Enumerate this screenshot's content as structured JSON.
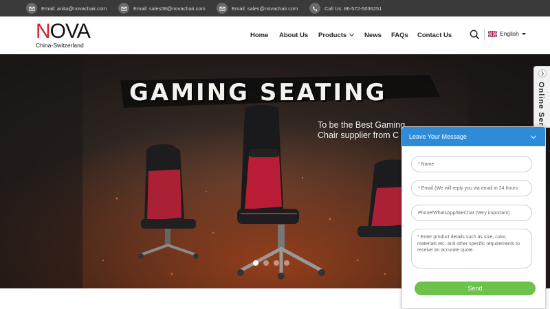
{
  "topbar": {
    "items": [
      {
        "icon": "mail-icon",
        "text": "Email: anita@novachair.com"
      },
      {
        "icon": "mail-icon",
        "text": "Email: sales08@novachair.com"
      },
      {
        "icon": "mail-icon",
        "text": "Email: sales@novachair.com"
      },
      {
        "icon": "phone-icon",
        "text": "Call Us: 86-572-5036251"
      }
    ]
  },
  "logo": {
    "word_red": "N",
    "word_dark": "OVA",
    "subtitle": "China-Switzerland"
  },
  "nav": {
    "items": [
      "Home",
      "About Us",
      "Products",
      "News",
      "FAQs",
      "Contact Us"
    ],
    "language": "English"
  },
  "hero": {
    "title": "GAMING SEATING",
    "subtitle_line1": "To be the Best Gaming",
    "subtitle_line2": "Chair supplier from C",
    "slides": 4,
    "active_slide": 1
  },
  "online_service": {
    "label": "Online Serv"
  },
  "chat": {
    "title": "Leave Your Message",
    "name_placeholder": "* Name",
    "email_placeholder": "* Email (We will reply you via email in 24 hours",
    "phone_placeholder": "Phone/WhatsApp/WeChat (Very important)",
    "details_placeholder": "* Enter product details such as size, color, materials etc. and other specific requirements to receive an accurate quote.",
    "send_label": "Send"
  },
  "colors": {
    "topbar": "#3a3a3a",
    "brand_red": "#d0232a",
    "chat_header": "#2e8bd8",
    "send_button": "#6cc24a"
  }
}
